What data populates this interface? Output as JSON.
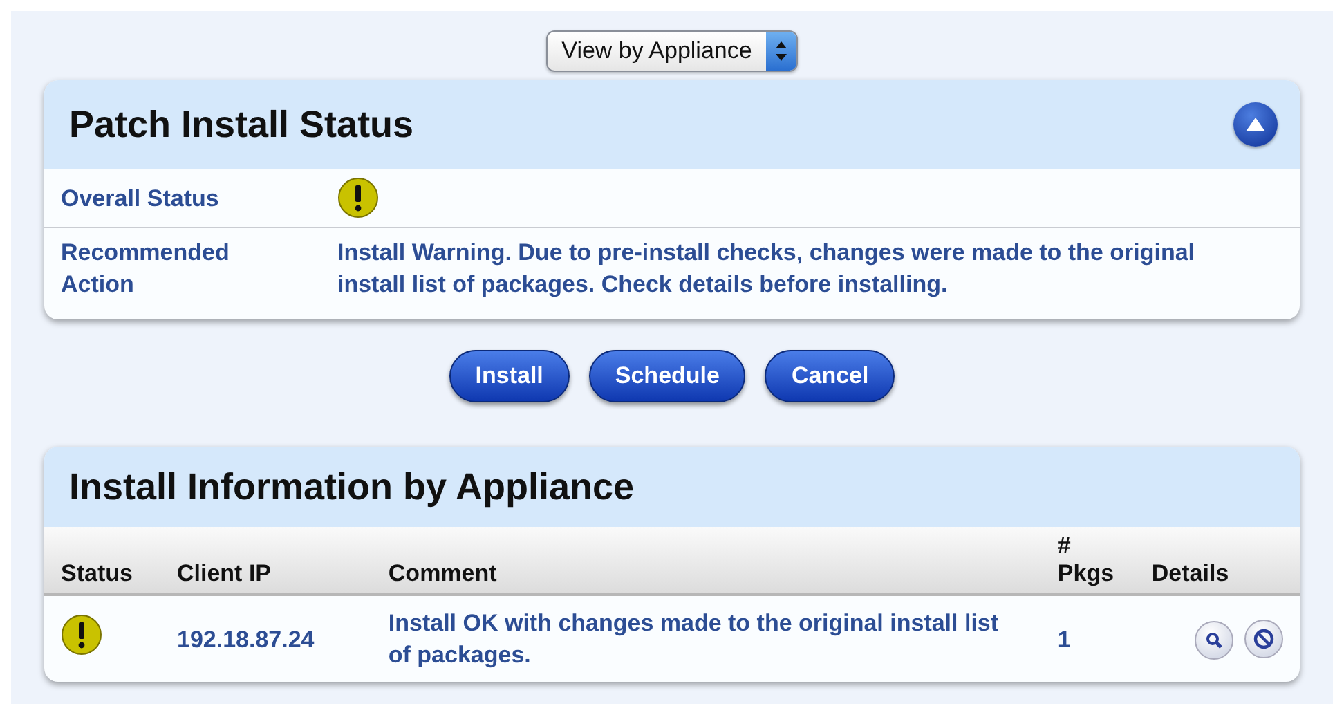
{
  "view_select": {
    "value": "View by Appliance"
  },
  "status_panel": {
    "title": "Patch Install Status",
    "expanded": true,
    "rows": [
      {
        "label": "Overall Status",
        "kind": "status",
        "warning": true
      },
      {
        "label": "Recommended Action",
        "kind": "text",
        "value": "Install Warning. Due to pre-install checks, changes were made to the original install list of packages. Check details before installing."
      }
    ]
  },
  "buttons": [
    "Install",
    "Schedule",
    "Cancel"
  ],
  "appliance_panel": {
    "title": "Install Information by Appliance",
    "columns": [
      "Status",
      "Client IP",
      "Comment",
      "# Pkgs",
      "Details"
    ],
    "rows": [
      {
        "warning": true,
        "client_ip": "192.18.87.24",
        "comment": "Install OK with changes made to the original install list of packages.",
        "pkgs": "1"
      }
    ]
  }
}
